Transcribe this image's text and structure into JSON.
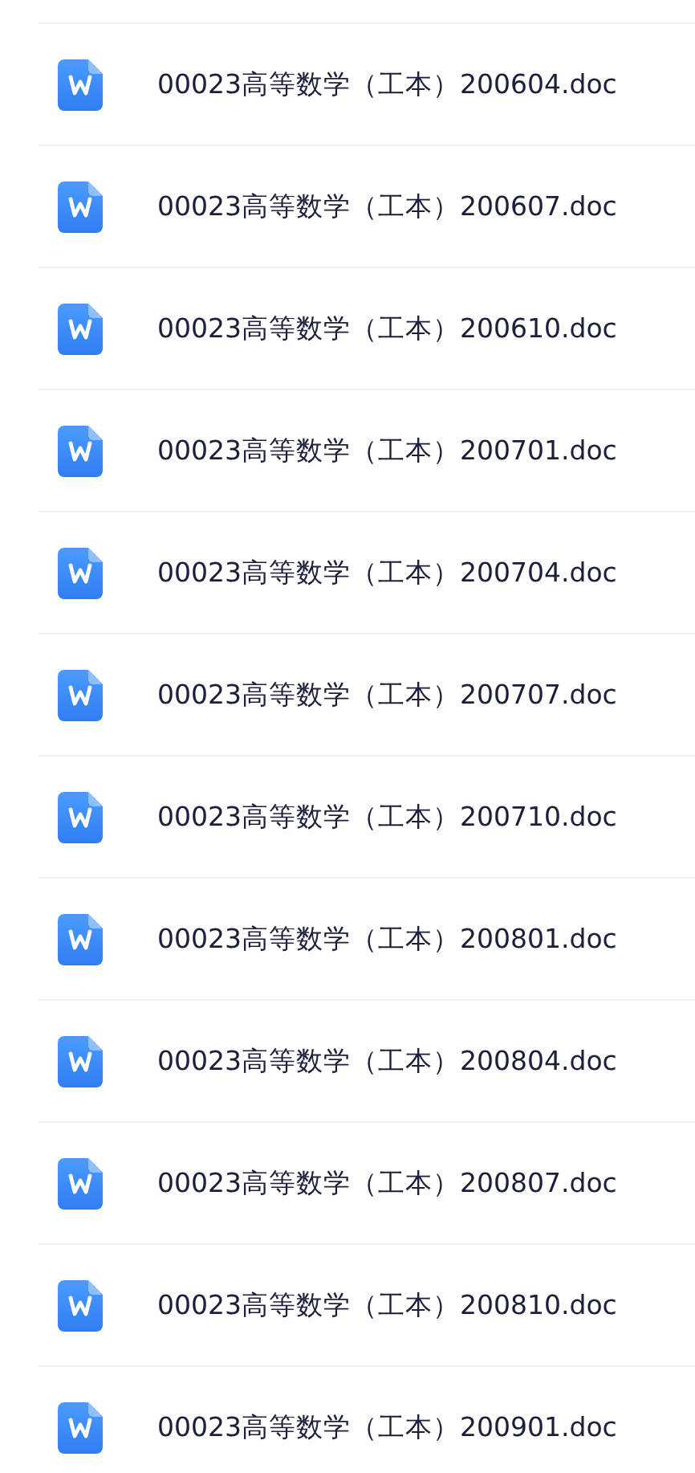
{
  "files": [
    {
      "name": "00023高等数学（工本）200604.doc"
    },
    {
      "name": "00023高等数学（工本）200607.doc"
    },
    {
      "name": "00023高等数学（工本）200610.doc"
    },
    {
      "name": "00023高等数学（工本）200701.doc"
    },
    {
      "name": "00023高等数学（工本）200704.doc"
    },
    {
      "name": "00023高等数学（工本）200707.doc"
    },
    {
      "name": "00023高等数学（工本）200710.doc"
    },
    {
      "name": "00023高等数学（工本）200801.doc"
    },
    {
      "name": "00023高等数学（工本）200804.doc"
    },
    {
      "name": "00023高等数学（工本）200807.doc"
    },
    {
      "name": "00023高等数学（工本）200810.doc"
    },
    {
      "name": "00023高等数学（工本）200901.doc"
    }
  ]
}
